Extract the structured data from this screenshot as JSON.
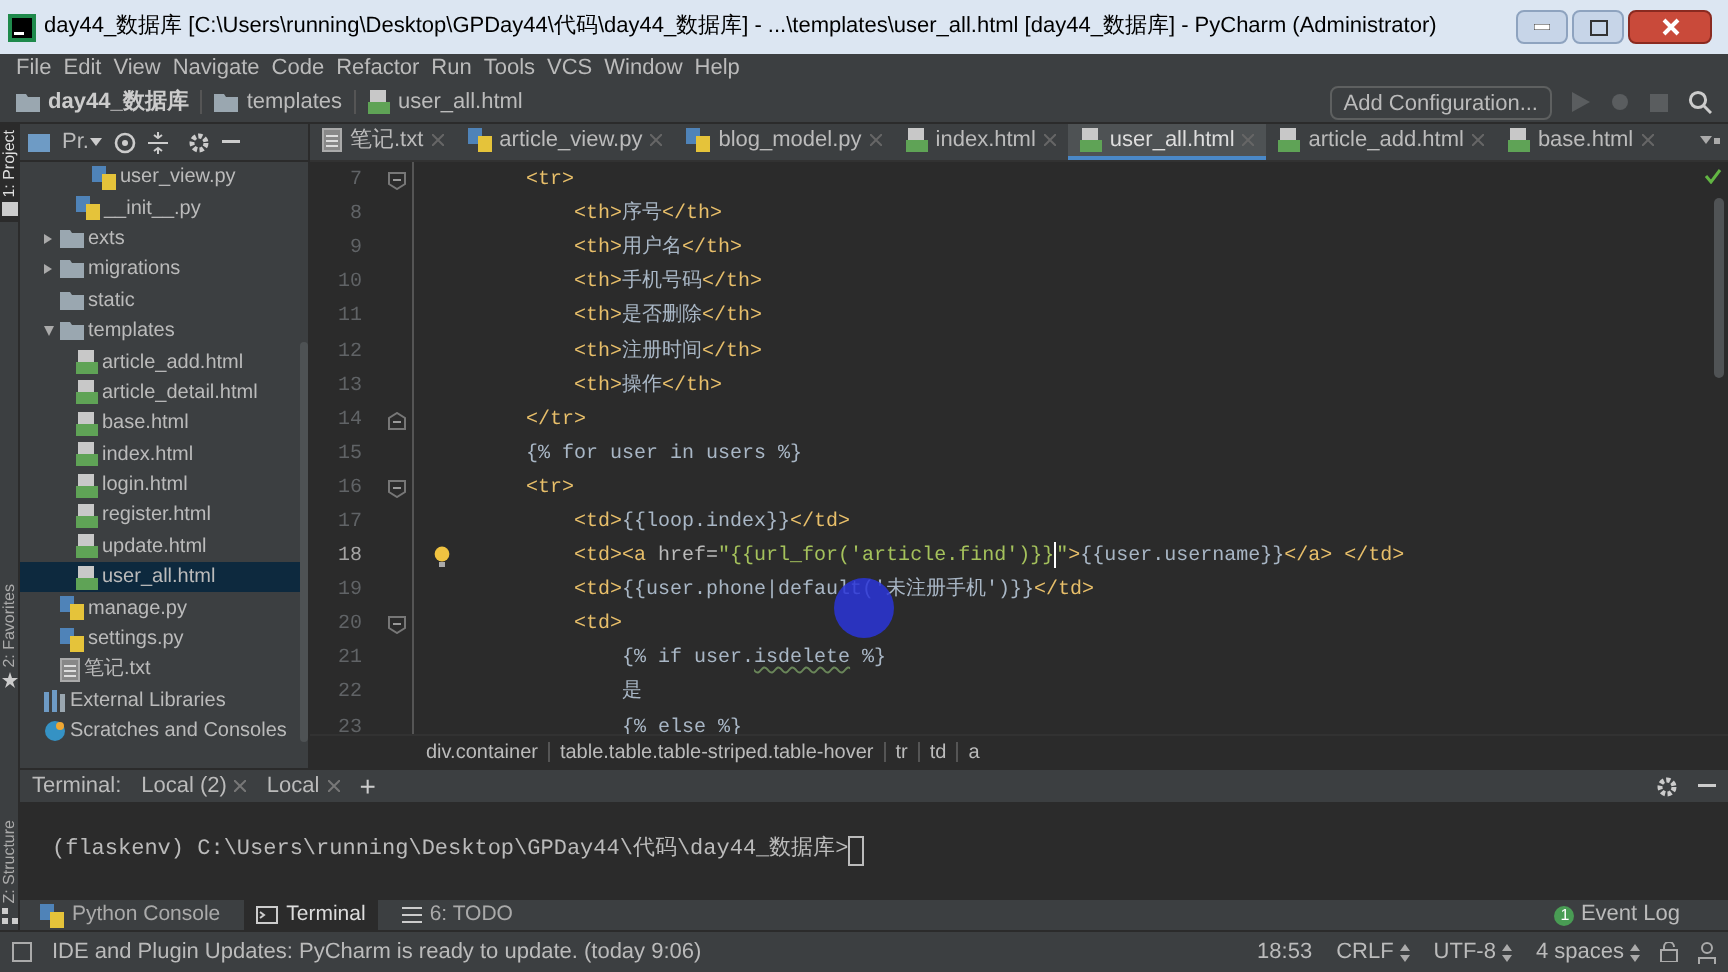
{
  "window": {
    "title": "day44_数据库 [C:\\Users\\running\\Desktop\\GPDay44\\代码\\day44_数据库] - ...\\templates\\user_all.html [day44_数据库] - PyCharm (Administrator)"
  },
  "menu": [
    "File",
    "Edit",
    "View",
    "Navigate",
    "Code",
    "Refactor",
    "Run",
    "Tools",
    "VCS",
    "Window",
    "Help"
  ],
  "navigation": {
    "breadcrumbs": [
      {
        "label": "day44_数据库",
        "kind": "folder"
      },
      {
        "label": "templates",
        "kind": "folder"
      },
      {
        "label": "user_all.html",
        "kind": "html"
      }
    ],
    "run_config": "Add Configuration..."
  },
  "tool_strip": [
    {
      "label": "1: Project",
      "selected": true,
      "kind": "project"
    },
    {
      "label": "2: Favorites",
      "selected": false,
      "kind": "favorites"
    },
    {
      "label": "Z: Structure",
      "selected": false,
      "kind": "structure"
    }
  ],
  "project": {
    "view": "Pr.",
    "tree": [
      {
        "kind": "hidden",
        "children": [
          {
            "kind": "hidden",
            "children": [
              {
                "kind": "hidden",
                "children": [
                  {
                    "label": "user_view.py",
                    "kind": "python",
                    "selected": false
                  }
                ]
              },
              {
                "label": "__init__.py",
                "kind": "python",
                "selected": false
              }
            ]
          },
          {
            "label": "exts",
            "kind": "folder",
            "expanded": false,
            "selected": false
          },
          {
            "label": "migrations",
            "kind": "folder",
            "expanded": false,
            "selected": false
          },
          {
            "label": "static",
            "kind": "folder",
            "selected": false
          },
          {
            "label": "templates",
            "kind": "folder",
            "expanded": true,
            "selected": false,
            "children": [
              {
                "label": "article_add.html",
                "kind": "html",
                "selected": false
              },
              {
                "label": "article_detail.html",
                "kind": "html",
                "selected": false
              },
              {
                "label": "base.html",
                "kind": "html",
                "selected": false
              },
              {
                "label": "index.html",
                "kind": "html",
                "selected": false
              },
              {
                "label": "login.html",
                "kind": "html",
                "selected": false
              },
              {
                "label": "register.html",
                "kind": "html",
                "selected": false
              },
              {
                "label": "update.html",
                "kind": "html",
                "selected": false
              },
              {
                "label": "user_all.html",
                "kind": "html",
                "selected": true
              }
            ]
          },
          {
            "label": "manage.py",
            "kind": "python",
            "selected": false
          },
          {
            "label": "settings.py",
            "kind": "python",
            "selected": false
          },
          {
            "label": "笔记.txt",
            "kind": "txt",
            "selected": false
          }
        ]
      },
      {
        "label": "External Libraries",
        "kind": "library",
        "selected": false
      },
      {
        "label": "Scratches and Consoles",
        "kind": "scratches",
        "selected": false
      }
    ]
  },
  "editor": {
    "tabs": [
      {
        "label": "笔记.txt",
        "kind": "txt",
        "selected": false
      },
      {
        "label": "article_view.py",
        "kind": "python",
        "selected": false
      },
      {
        "label": "blog_model.py",
        "kind": "python",
        "selected": false
      },
      {
        "label": "index.html",
        "kind": "html",
        "selected": false
      },
      {
        "label": "user_all.html",
        "kind": "html",
        "selected": true
      },
      {
        "label": "article_add.html",
        "kind": "html",
        "selected": false
      },
      {
        "label": "base.html",
        "kind": "html",
        "selected": false
      }
    ],
    "lines": [
      {
        "number": "7",
        "fold_start": true,
        "segments": [
          {
            "kind": "tag",
            "text": "        <tr>"
          }
        ]
      },
      {
        "number": "8",
        "segments": [
          {
            "kind": "tag",
            "text": "            <th>"
          },
          {
            "kind": "text",
            "text": "序号"
          },
          {
            "kind": "tag",
            "text": "</th>"
          }
        ]
      },
      {
        "number": "9",
        "segments": [
          {
            "kind": "tag",
            "text": "            <th>"
          },
          {
            "kind": "text",
            "text": "用户名"
          },
          {
            "kind": "tag",
            "text": "</th>"
          }
        ]
      },
      {
        "number": "10",
        "segments": [
          {
            "kind": "tag",
            "text": "            <th>"
          },
          {
            "kind": "text",
            "text": "手机号码"
          },
          {
            "kind": "tag",
            "text": "</th>"
          }
        ]
      },
      {
        "number": "11",
        "segments": [
          {
            "kind": "tag",
            "text": "            <th>"
          },
          {
            "kind": "text",
            "text": "是否删除"
          },
          {
            "kind": "tag",
            "text": "</th>"
          }
        ]
      },
      {
        "number": "12",
        "segments": [
          {
            "kind": "tag",
            "text": "            <th>"
          },
          {
            "kind": "text",
            "text": "注册时间"
          },
          {
            "kind": "tag",
            "text": "</th>"
          }
        ]
      },
      {
        "number": "13",
        "segments": [
          {
            "kind": "tag",
            "text": "            <th>"
          },
          {
            "kind": "text",
            "text": "操作"
          },
          {
            "kind": "tag",
            "text": "</th>"
          }
        ]
      },
      {
        "number": "14",
        "fold_end": true,
        "segments": [
          {
            "kind": "tag",
            "text": "        </tr>"
          }
        ]
      },
      {
        "number": "15",
        "segments": [
          {
            "kind": "text",
            "text": "        {% for user in users %}"
          }
        ]
      },
      {
        "number": "16",
        "fold_start": true,
        "segments": [
          {
            "kind": "tag",
            "text": "        <tr>"
          }
        ]
      },
      {
        "number": "17",
        "segments": [
          {
            "kind": "tag",
            "text": "            <td>"
          },
          {
            "kind": "text",
            "text": "{{loop.index}}"
          },
          {
            "kind": "tag",
            "text": "</td>"
          }
        ]
      },
      {
        "number": "18",
        "current": true,
        "bulb": true,
        "segments": [
          {
            "kind": "tag",
            "text": "            <td><a "
          },
          {
            "kind": "attr",
            "text": "href="
          },
          {
            "kind": "string",
            "text": "\"{{url_for('article.find')}}",
            "caret": true
          },
          {
            "kind": "string",
            "text": "\""
          },
          {
            "kind": "tag",
            "text": ">"
          },
          {
            "kind": "text",
            "text": "{{user.username}}"
          },
          {
            "kind": "tag",
            "text": "</a> </td>"
          }
        ]
      },
      {
        "number": "19",
        "segments": [
          {
            "kind": "tag",
            "text": "            <td>"
          },
          {
            "kind": "text",
            "text": "{{user.phone|default('未注册手机')}}"
          },
          {
            "kind": "tag",
            "text": "</td>"
          }
        ]
      },
      {
        "number": "20",
        "fold_start": true,
        "segments": [
          {
            "kind": "tag",
            "text": "            <td>"
          }
        ]
      },
      {
        "number": "21",
        "segments": [
          {
            "kind": "text",
            "text": "                {% if user."
          },
          {
            "kind": "warning",
            "text": "isdelete"
          },
          {
            "kind": "text",
            "text": " %}"
          }
        ]
      },
      {
        "number": "22",
        "segments": [
          {
            "kind": "text",
            "text": "                是"
          }
        ]
      },
      {
        "number": "23",
        "segments": [
          {
            "kind": "text",
            "text": "                {% else %}"
          }
        ]
      }
    ],
    "breadcrumbs": [
      "div.container",
      "table.table.table-striped.table-hover",
      "tr",
      "td",
      "a"
    ]
  },
  "terminal": {
    "label": "Terminal:",
    "tabs": [
      "Local (2)",
      "Local"
    ],
    "add": "+",
    "prompt": "(flaskenv) C:\\Users\\running\\Desktop\\GPDay44\\代码\\day44_数据库>"
  },
  "tool_tabs": [
    {
      "label": "Python Console",
      "kind": "python",
      "selected": false
    },
    {
      "label": "Terminal",
      "kind": "terminal",
      "selected": true
    },
    {
      "label": "6: TODO",
      "kind": "todo",
      "selected": false
    }
  ],
  "event_log": {
    "label": "Event Log",
    "count": "1"
  },
  "status_bar": {
    "message": "IDE and Plugin Updates: PyCharm is ready to update. (today 9:06)",
    "items": [
      "18:53",
      "CRLF",
      "UTF-8",
      "4 spaces"
    ]
  }
}
